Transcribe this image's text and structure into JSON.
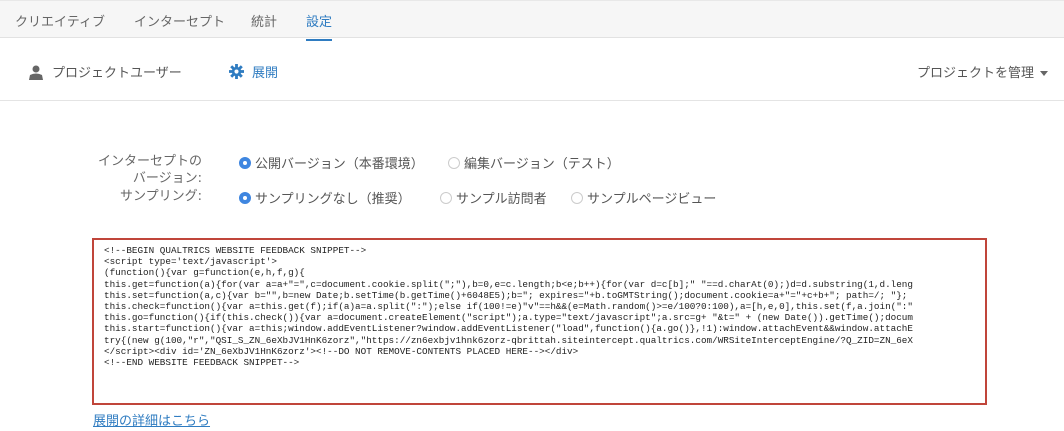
{
  "tabs": [
    {
      "label": "クリエイティブ"
    },
    {
      "label": "インターセプト"
    },
    {
      "label": "統計"
    },
    {
      "label": "設定",
      "active": true
    }
  ],
  "subnav": {
    "users": "プロジェクトユーザー",
    "deploy": "展開",
    "manage": "プロジェクトを管理"
  },
  "form": {
    "version_label": "インターセプトの\nバージョン:",
    "version_options": [
      "公開バージョン（本番環境）",
      "編集バージョン（テスト）"
    ],
    "sampling_label": "サンプリング:",
    "sampling_options": [
      "サンプリングなし（推奨）",
      "サンプル訪問者",
      "サンプルページビュー"
    ]
  },
  "code": "<!--BEGIN QUALTRICS WEBSITE FEEDBACK SNIPPET-->\n<script type='text/javascript'>\n(function(){var g=function(e,h,f,g){\nthis.get=function(a){for(var a=a+\"=\",c=document.cookie.split(\";\"),b=0,e=c.length;b<e;b++){for(var d=c[b];\" \"==d.charAt(0);)d=d.substring(1,d.leng\nthis.set=function(a,c){var b=\"\",b=new Date;b.setTime(b.getTime()+6048E5);b=\"; expires=\"+b.toGMTString();document.cookie=a+\"=\"+c+b+\"; path=/; \"};\nthis.check=function(){var a=this.get(f);if(a)a=a.split(\":\");else if(100!=e)\"v\"==h&&(e=Math.random()>=e/100?0:100),a=[h,e,0],this.set(f,a.join(\":\"\nthis.go=function(){if(this.check()){var a=document.createElement(\"script\");a.type=\"text/javascript\";a.src=g+ \"&t=\" + (new Date()).getTime();docum\nthis.start=function(){var a=this;window.addEventListener?window.addEventListener(\"load\",function(){a.go()},!1):window.attachEvent&&window.attachE\ntry{(new g(100,\"r\",\"QSI_S_ZN_6eXbJV1HnK6zorz\",\"https://zn6exbjv1hnk6zorz-qbrittah.siteintercept.qualtrics.com/WRSiteInterceptEngine/?Q_ZID=ZN_6eX\n</script><div id='ZN_6eXbJV1HnK6zorz'><!--DO NOT REMOVE-CONTENTS PLACED HERE--></div>\n<!--END WEBSITE FEEDBACK SNIPPET-->",
  "details_link": "展開の詳細はこちら",
  "colors": {
    "accent": "#2f7cc1",
    "radio": "#3f86e0",
    "code_border": "#c0453a"
  }
}
